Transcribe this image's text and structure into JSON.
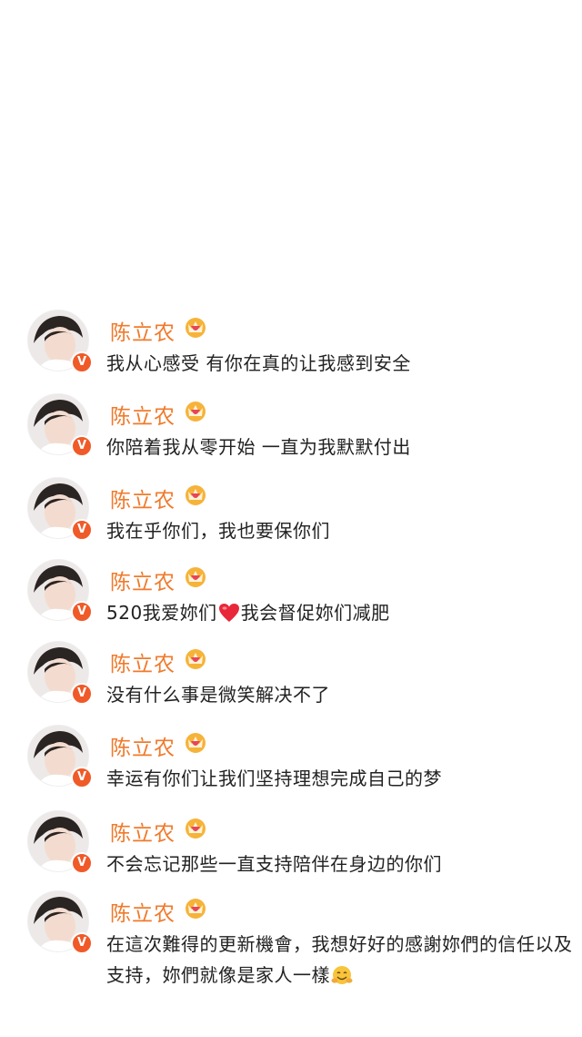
{
  "posts": [
    {
      "name": "陈立农",
      "text_parts": [
        "我从心感受 有你在真的让我感到安全"
      ]
    },
    {
      "name": "陈立农",
      "text_parts": [
        "你陪着我从零开始 一直为我默默付出"
      ]
    },
    {
      "name": "陈立农",
      "text_parts": [
        "我在乎你们，我也要保你们"
      ]
    },
    {
      "name": "陈立农",
      "text_parts": [
        "520我爱妳们",
        "我会督促妳们减肥"
      ],
      "emoji": "heart-icon"
    },
    {
      "name": "陈立农",
      "text_parts": [
        "没有什么事是微笑解决不了"
      ]
    },
    {
      "name": "陈立农",
      "text_parts": [
        "幸运有你们让我们坚持理想完成自己的梦"
      ]
    },
    {
      "name": "陈立农",
      "text_parts": [
        "不会忘记那些一直支持陪伴在身边的你们"
      ]
    },
    {
      "name": "陈立农",
      "text_parts": [
        "在這次難得的更新機會，我想好好的感謝妳們的信任以及支持，妳們就像是家人一樣"
      ],
      "emoji": "smile-icon"
    }
  ],
  "colors": {
    "name": "#f07a2b",
    "badge": "#f05a28",
    "text": "#222222"
  }
}
